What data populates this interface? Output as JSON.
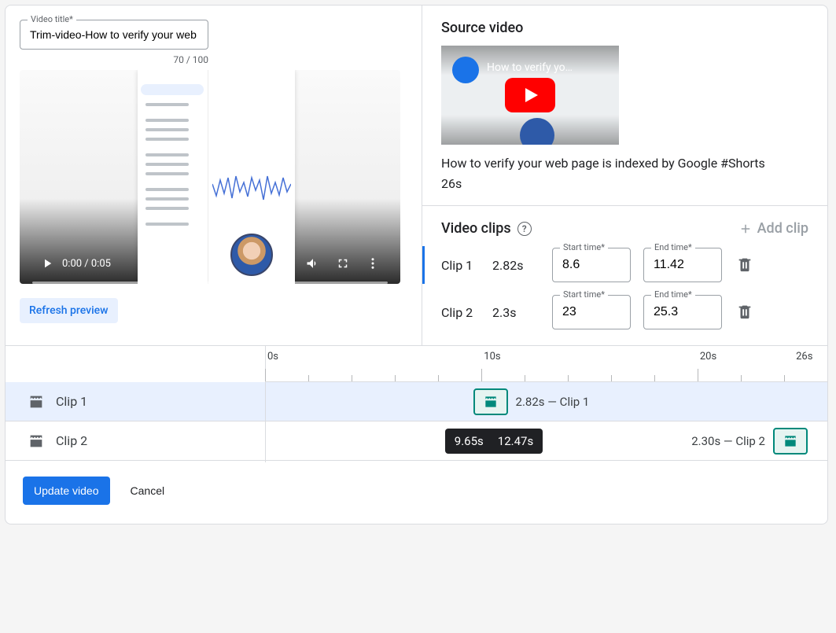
{
  "left": {
    "titleFieldLabel": "Video title*",
    "titleValue": "Trim-video-How to verify your web page is indexed",
    "counter": "70 / 100",
    "player": {
      "time": "0:00 / 0:05"
    },
    "refresh": "Refresh preview"
  },
  "source": {
    "heading": "Source video",
    "thumbTitle": "How to verify yo…",
    "title": "How to verify your web page is indexed by Google #Shorts",
    "duration": "26s"
  },
  "clips": {
    "heading": "Video clips",
    "add": "Add clip",
    "startLabel": "Start time*",
    "endLabel": "End time*",
    "list": [
      {
        "name": "Clip 1",
        "dur": "2.82s",
        "start": "8.6",
        "end": "11.42"
      },
      {
        "name": "Clip 2",
        "dur": "2.3s",
        "start": "23",
        "end": "25.3"
      }
    ]
  },
  "timeline": {
    "marks": [
      "0s",
      "10s",
      "20s",
      "26s"
    ],
    "rows": [
      {
        "name": "Clip 1",
        "chipText": "2.82s — Clip 1"
      },
      {
        "name": "Clip 2",
        "chipText": "2.30s — Clip 2"
      }
    ],
    "tooltip": {
      "a": "9.65s",
      "b": "12.47s"
    }
  },
  "footer": {
    "primary": "Update video",
    "cancel": "Cancel"
  }
}
